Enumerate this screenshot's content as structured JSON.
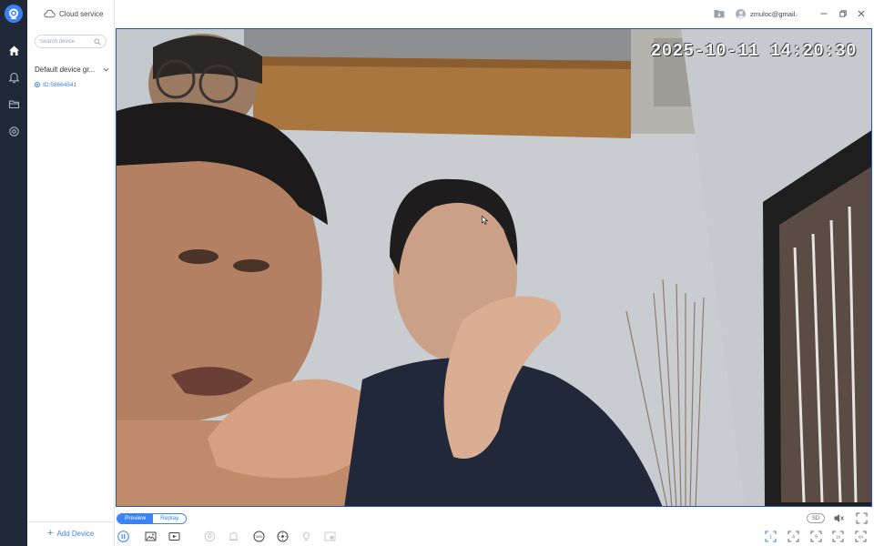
{
  "sidebar": {
    "cloud_label": "Cloud service",
    "search_placeholder": "Search device",
    "group_label": "Default device gr...",
    "device_id": "ID:58664541",
    "add_device": "Add Device"
  },
  "rail": {
    "items": [
      "home-icon",
      "bell-icon",
      "folder-icon",
      "settings-icon"
    ]
  },
  "header": {
    "user_email": "zmuloc@gmail.c"
  },
  "video": {
    "timestamp": "2025-10-11 14:20:30"
  },
  "controls": {
    "tabs": [
      {
        "label": "Preview",
        "active": true
      },
      {
        "label": "Replay",
        "active": false
      }
    ],
    "quality": "SD",
    "icons_left": [
      "pause-icon",
      "snapshot-icon",
      "record-icon",
      "talk-icon",
      "alarm-icon",
      "360-view-icon",
      "ptz-icon",
      "light-icon",
      "picture-in-picture-icon"
    ],
    "label_360": "360",
    "icons_right": [
      "mute-icon",
      "fullscreen-icon",
      "single-view-icon",
      "four-split-icon",
      "nine-split-icon",
      "sixteen-split-icon",
      "sixty-four-split-icon"
    ],
    "split_labels": [
      "1",
      "4",
      "9",
      "16",
      "64"
    ]
  },
  "colors": {
    "accent": "#3b82f6",
    "rail": "#1f2937",
    "video_border": "#1d4ed8"
  }
}
